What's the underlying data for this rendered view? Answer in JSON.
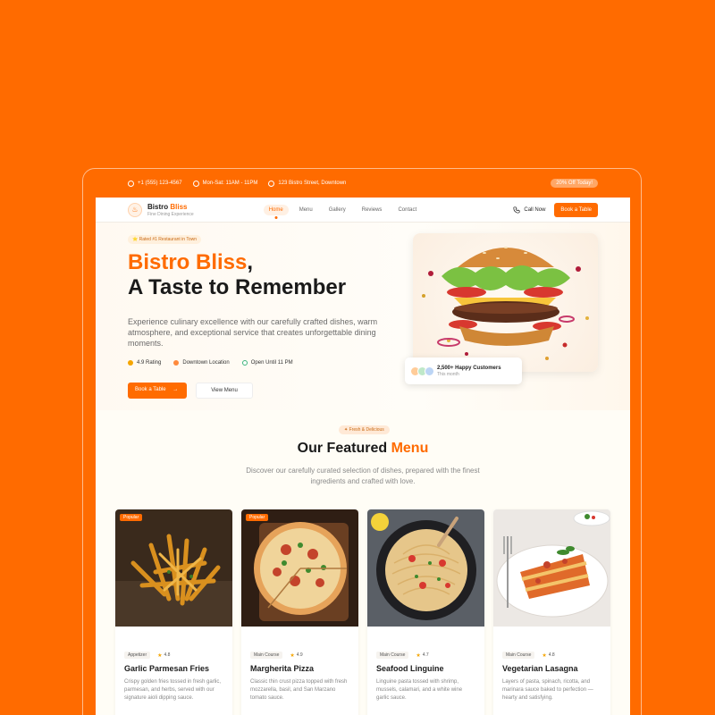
{
  "topbar": {
    "phone": "+1 (555) 123-4567",
    "hours": "Mon-Sat: 11AM - 11PM",
    "address": "123 Bistro Street, Downtown",
    "offer": "20% Off Today!"
  },
  "nav": {
    "brand_first": "Bistro ",
    "brand_accent": "Bliss",
    "brand_sub": "Fine Dining Experience",
    "links": [
      "Home",
      "Menu",
      "Gallery",
      "Reviews",
      "Contact"
    ],
    "call_label": "Call Now",
    "book_label": "Book a Table"
  },
  "hero": {
    "badge": "Rated #1 Restaurant in Town",
    "title_accent": "Bistro Bliss",
    "title_comma": ",",
    "title_line2": "A Taste to Remember",
    "description": "Experience culinary excellence with our carefully crafted dishes, warm atmosphere, and exceptional service that creates unforgettable dining moments.",
    "features": [
      "4.9 Rating",
      "Downtown Location",
      "Open Until 11 PM"
    ],
    "book_button": "Book a Table",
    "menu_button": "View Menu",
    "customers_title": "2,500+ Happy Customers",
    "customers_sub": "This month"
  },
  "menu_section": {
    "badge": "Fresh & Delicious",
    "title_plain": "Our Featured ",
    "title_accent": "Menu",
    "description": "Discover our carefully curated selection of dishes, prepared with the finest ingredients and crafted with love."
  },
  "cards": [
    {
      "badge": "Popular",
      "category": "Appetizer",
      "rating": "4.8",
      "name": "Garlic Parmesan Fries",
      "desc": "Crispy golden fries tossed in fresh garlic, parmesan, and herbs, served with our signature aioli dipping sauce."
    },
    {
      "badge": "Popular",
      "category": "Main Course",
      "rating": "4.9",
      "name": "Margherita Pizza",
      "desc": "Classic thin crust pizza topped with fresh mozzarella, basil, and San Marzano tomato sauce."
    },
    {
      "badge": "",
      "category": "Main Course",
      "rating": "4.7",
      "name": "Seafood Linguine",
      "desc": "Linguine pasta tossed with shrimp, mussels, calamari, and a white wine garlic sauce."
    },
    {
      "badge": "",
      "category": "Main Course",
      "rating": "4.8",
      "name": "Vegetarian Lasagna",
      "desc": "Layers of pasta, spinach, ricotta, and marinara sauce baked to perfection — hearty and satisfying."
    }
  ],
  "colors": {
    "brand": "#ff6b00",
    "star": "#f5a500"
  }
}
